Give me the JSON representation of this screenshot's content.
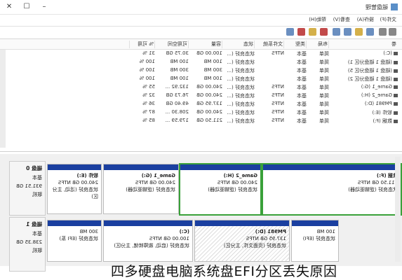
{
  "window": {
    "title": "磁盘管理"
  },
  "menu": [
    "文件(F)",
    "操作(A)",
    "查看(V)",
    "帮助(H)"
  ],
  "columns": [
    "卷",
    "布局",
    "类型",
    "文件系统",
    "状态",
    "容量",
    "可用空间",
    "% 可用"
  ],
  "rows": [
    [
      "(C:)",
      "简单",
      "基本",
      "NTFS",
      "状态良好 (...",
      "100.00 GB",
      "30.75 GB",
      "31 %"
    ],
    [
      "(磁盘 1 磁盘分区 1)",
      "简单",
      "基本",
      "",
      "状态良好 (...",
      "100 MB",
      "100 MB",
      "100 %"
    ],
    [
      "(磁盘 1 磁盘分区 5)",
      "简单",
      "基本",
      "",
      "状态良好 (...",
      "300 MB",
      "300 MB",
      "100 %"
    ],
    [
      "(磁盘 1 磁盘分区 2)",
      "简单",
      "基本",
      "",
      "状态良好 (...",
      "100 MB",
      "100 MB",
      "100 %"
    ],
    [
      "Game_1 (G:)",
      "简单",
      "基本",
      "NTFS",
      "状态良好 (...",
      "240.00 GB",
      "132.92 ...",
      "55 %"
    ],
    [
      "Game_2 (H:)",
      "简单",
      "基本",
      "NTFS",
      "状态良好 (...",
      "240.00 GB",
      "76.73 GB",
      "32 %"
    ],
    [
      "PM981 (D:)",
      "简单",
      "基本",
      "NTFS",
      "状态良好 (...",
      "137.95 GB",
      "49.40 GB",
      "36 %"
    ],
    [
      "软件 (E:)",
      "简单",
      "基本",
      "NTFS",
      "状态良好 (...",
      "240.00 GB",
      "208.30 ...",
      "87 %"
    ],
    [
      "数据 (F:)",
      "简单",
      "基本",
      "NTFS",
      "状态良好 (...",
      "211.50 GB",
      "179.59 ...",
      "85 %"
    ]
  ],
  "disk0": {
    "label": {
      "name": "磁盘 0",
      "type": "基本",
      "size": "931.51 GB",
      "status": "联机"
    },
    "partitions": [
      {
        "name": "软件 (E:)",
        "size": "240.00 GB NTFS",
        "status": "状态良好 (活动, 主分区)"
      },
      {
        "name": "Game_2 (H:)",
        "size": "240.00 GB NTFS",
        "status": "状态良好 (逻辑驱动器)"
      },
      {
        "name": "Game_1 (G:)",
        "size": "240.00 GB NTFS",
        "status": "状态良好 (逻辑驱动器)"
      },
      {
        "name": "数据 (F:)",
        "size": "211.50 GB NTFS",
        "status": "状态良好 (逻辑驱动器)"
      }
    ]
  },
  "disk1": {
    "label": {
      "name": "磁盘 1",
      "type": "基本",
      "size": "238.35 GB",
      "status": "联机"
    },
    "partitions": [
      {
        "name": "",
        "size": "300 MB",
        "status": "状态良好 (EFI 系)"
      },
      {
        "name": "(C:)",
        "size": "100.00 GB NTFS",
        "status": "状态良好 (启动, 故障转储, 主分区)"
      },
      {
        "name": "PM981 (D:)",
        "size": "137.95 GB NTFS",
        "status": "状态良好 (页面文件, 主分区)"
      },
      {
        "name": "",
        "size": "100 MB",
        "status": "状态良好 (EFI)"
      }
    ]
  },
  "caption": "四多硬盘电脑系统盘EFI分区丢失原因"
}
